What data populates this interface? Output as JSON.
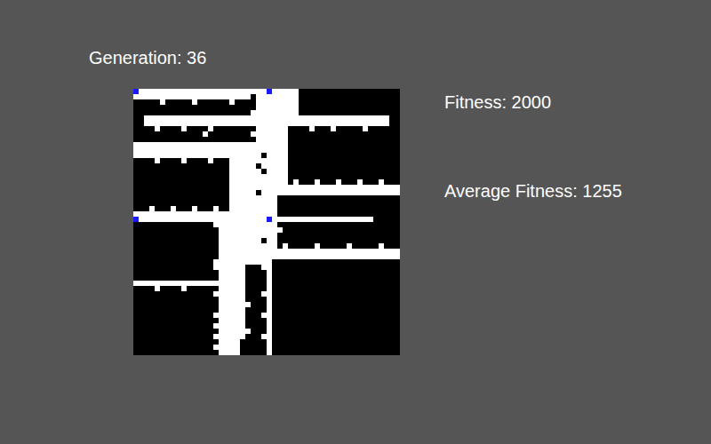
{
  "generation": "Generation: 36",
  "fitness": "Fitness: 2000",
  "average_fitness": "Average Fitness: 1255",
  "grid": {
    "rows": [
      "B########################B#####...................",
      "######################.########...................",
      ".....#.....#......#....########...................",
      ".......................########...................",
      "......................#########...................",
      "..##############################################..",
      "..##############################################..",
      "....#....#....#........######....#...#.....#......",
      ".............#........#######.....................",
      ".......................######.....................",
      "#############################.....................",
      "#############################.....................",
      "########################.####.....................",
      "....#....#....#...###########.....................",
      "..................#####.#####.....................",
      "..................######.####.....................",
      "..................###########.....................",
      "..................###########.#...#...#...#...#...",
      "..................################################",
      "..................#####.##########################",
      "..................#########.......................",
      "..................#########.......................",
      "...#...#...#...#..#########.......................",
      "###########################.......................",
      "B########################B###################.....",
      "...............############.......................",
      "................############......................",
      "................###########.......................",
      "................########.##.......................",
      "................###########.#.....#.....#.....#...",
      "................##################################",
      "................##################################",
      "...............###########........................",
      "...............######...##........................",
      "................#####....#........................",
      "................#####....#........................",
      "#####################....#........................",
      "....#....#......#####....#........................",
      "...............######...##........................",
      "................#####....#........................",
      "................######...#........................",
      "................#####....#........................",
      "...............######...##........................",
      "................#####....#........................",
      "...............######....#........................",
      "................######...#........................",
      "...............######...##........................",
      "................####.....#........................",
      "...............#####.....#........................",
      "................####.....#........................"
    ]
  }
}
